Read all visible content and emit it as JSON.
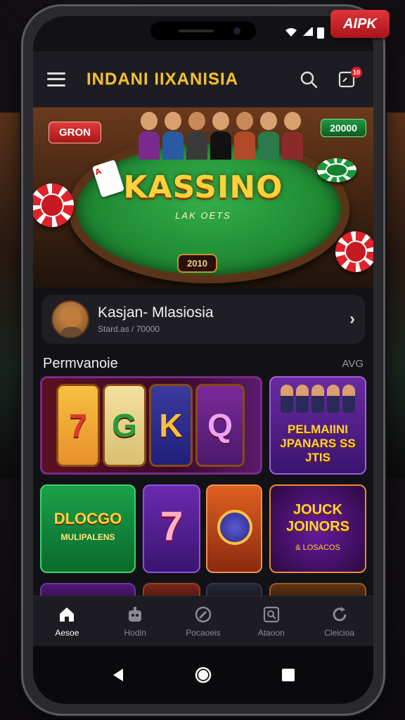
{
  "corner_badge": "AIPK",
  "header": {
    "title": "INDANI IIXANISIA",
    "notification_count": "10"
  },
  "hero": {
    "logo_text": "KASSINO",
    "subtitle": "LAK OETS",
    "badge_left": "GRON",
    "badge_right": "20000",
    "counter": "2010"
  },
  "profile": {
    "name": "Kasjan- Mlasiosia",
    "subtitle": "Stard.as / 70000"
  },
  "section": {
    "title": "Permvanoie",
    "link": "AVG"
  },
  "games": {
    "slot_reels": [
      "7",
      "G",
      "K",
      "Q"
    ],
    "promo_text": "PELMAIINI JPANARS SS JTIS",
    "bingo_title": "DLOCGO",
    "bingo_sub": "MULIPALENS",
    "seven": "7",
    "jokers_title": "JOUCK JOINORS",
    "jokers_sub": "& LOSACOS"
  },
  "tabs": [
    {
      "label": "Aesoe",
      "icon": "home-icon",
      "active": true
    },
    {
      "label": "Hodin",
      "icon": "robot-icon",
      "active": false
    },
    {
      "label": "Pocaoeis",
      "icon": "edit-icon",
      "active": false
    },
    {
      "label": "Ataoon",
      "icon": "search-box-icon",
      "active": false
    },
    {
      "label": "Cleicioa",
      "icon": "refresh-icon",
      "active": false
    }
  ],
  "colors": {
    "accent_gold": "#f0c030",
    "app_bar": "#1c1c22",
    "notif_red": "#e0202a"
  }
}
